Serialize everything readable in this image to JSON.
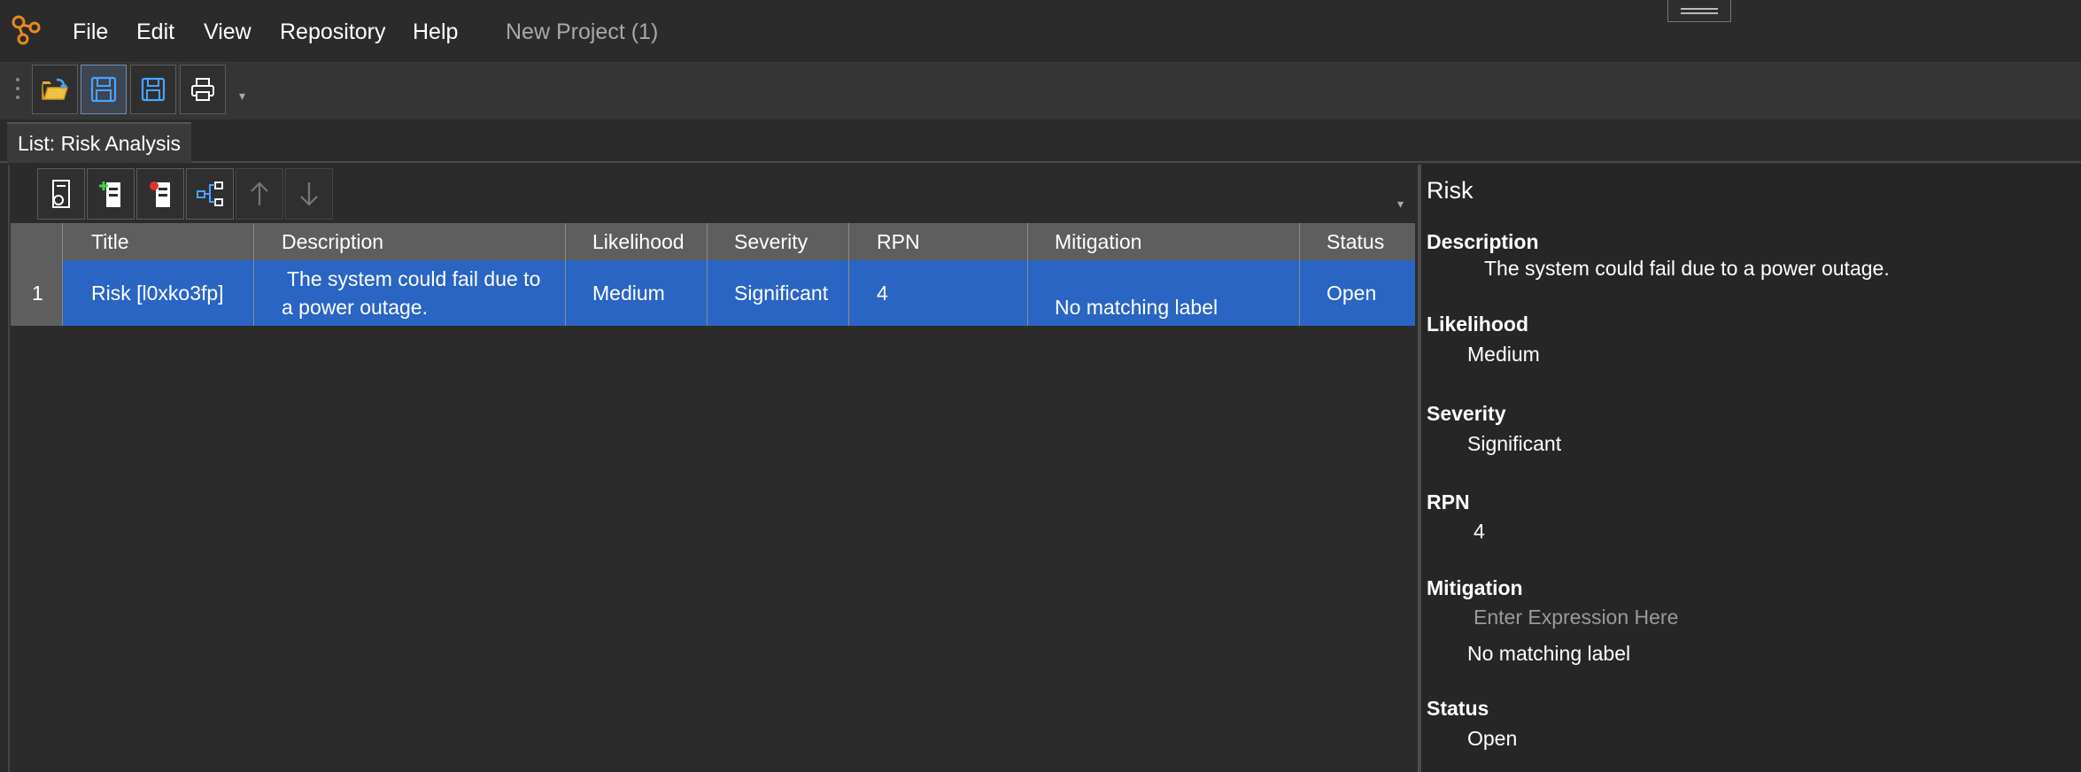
{
  "menubar": {
    "items": [
      "File",
      "Edit",
      "View",
      "Repository",
      "Help"
    ],
    "project_title": "New Project (1)"
  },
  "toolbar": {
    "buttons": [
      "open-folder-icon",
      "save-icon",
      "save-as-icon",
      "print-icon"
    ]
  },
  "tabs": [
    {
      "label": "List: Risk Analysis"
    }
  ],
  "grid_toolbar": {
    "buttons": [
      "settings-document-icon",
      "add-item-icon",
      "delete-item-icon",
      "hierarchy-icon",
      "arrow-up-icon",
      "arrow-down-icon"
    ]
  },
  "grid": {
    "columns": [
      "Title",
      "Description",
      "Likelihood",
      "Severity",
      "RPN",
      "Mitigation",
      "Status"
    ],
    "rows": [
      {
        "num": "1",
        "title": "Risk [l0xko3fp]",
        "description_line1": "The system could fail due to",
        "description_line2": "a power outage.",
        "likelihood": "Medium",
        "severity": "Significant",
        "rpn": "4",
        "mitigation": "No matching label",
        "status": "Open"
      }
    ]
  },
  "properties": {
    "title": "Risk",
    "description_label": "Description",
    "description_value": "The system could fail due to a power outage.",
    "likelihood_label": "Likelihood",
    "likelihood_value": "Medium",
    "severity_label": "Severity",
    "severity_value": "Significant",
    "rpn_label": "RPN",
    "rpn_value": "4",
    "mitigation_label": "Mitigation",
    "mitigation_placeholder": "Enter Expression Here",
    "mitigation_value": "No matching label",
    "status_label": "Status",
    "status_value": "Open"
  },
  "colors": {
    "background": "#2b2b2b",
    "selection": "#2a65c4",
    "header": "#5e5e5e",
    "accent_logo": "#e8891e"
  }
}
